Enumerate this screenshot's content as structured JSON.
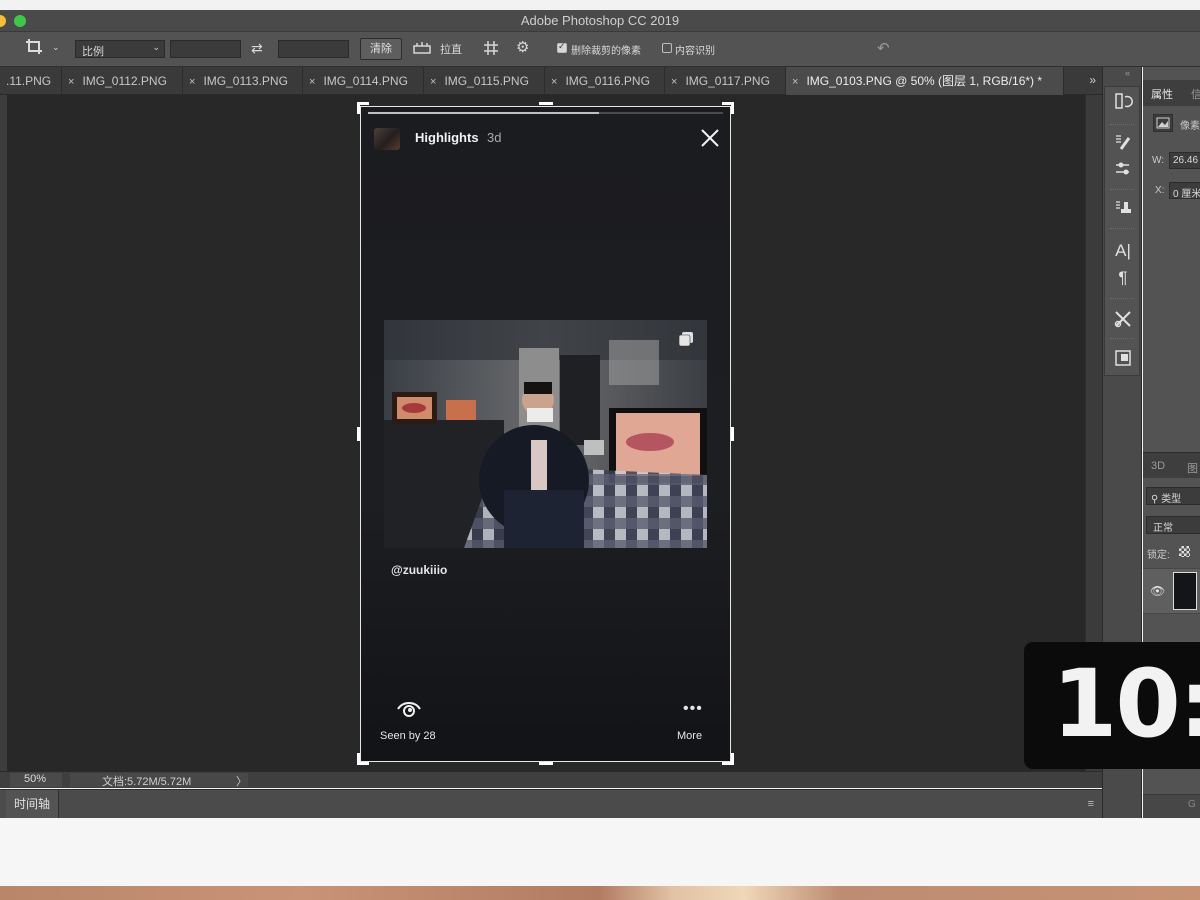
{
  "app": {
    "title": "Adobe Photoshop CC 2019"
  },
  "options_bar": {
    "ratio_label": "比例",
    "clear_label": "清除",
    "straighten_label": "拉直",
    "delete_cropped_label": "删除裁剪的像素",
    "content_aware_label": "内容识别",
    "delete_cropped_checked": true,
    "content_aware_checked": false
  },
  "tabs": [
    {
      "label": ".11.PNG"
    },
    {
      "label": "IMG_0112.PNG"
    },
    {
      "label": "IMG_0113.PNG"
    },
    {
      "label": "IMG_0114.PNG"
    },
    {
      "label": "IMG_0115.PNG"
    },
    {
      "label": "IMG_0116.PNG"
    },
    {
      "label": "IMG_0117.PNG"
    },
    {
      "label": "IMG_0103.PNG @ 50% (图层 1, RGB/16*) *",
      "active": true
    }
  ],
  "tabs_more": "»",
  "story": {
    "title": "Highlights",
    "age": "3d",
    "progress": 0.65,
    "handle": "@zuukiiio",
    "seen_label": "Seen by 28",
    "more_label": "More",
    "more_dots": "•••"
  },
  "statusbar": {
    "zoom": "50%",
    "doc_info": "文档:5.72M/5.72M",
    "arrow": "〉"
  },
  "timeline": {
    "label": "时间轴",
    "menu_icon": "≡"
  },
  "properties": {
    "tab_props": "属性",
    "tab_info": "信",
    "pixel_label": "像素",
    "w_label": "W:",
    "w_value": "26.46",
    "x_label": "X:",
    "x_value": "0 厘米"
  },
  "layers": {
    "tab_3d": "3D",
    "tab_layers": "图",
    "search_label": "类型",
    "blend_mode": "正常",
    "lock_label": "锁定:"
  },
  "panel_bottom": "G",
  "clock_overlay": "10:",
  "colors": {
    "app_bg": "#282828",
    "panel_bg": "#535353",
    "titlebar": "#4a4a4a",
    "story_bg": "#1b1c1f"
  }
}
